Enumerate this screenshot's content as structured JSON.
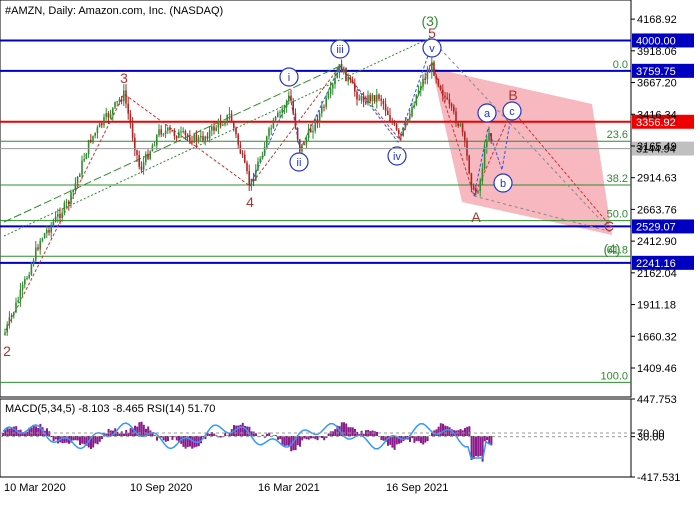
{
  "chart_data": {
    "type": "candlestick",
    "title": "#AMZN, Daily:  Amazon.com, Inc. (NASDAQ)",
    "x_ticks": [
      "10 Mar 2020",
      "10 Sep 2020",
      "16 Mar 2021",
      "16 Sep 2021"
    ],
    "price_axis": {
      "ylim": [
        1180,
        4320
      ],
      "ticks": [
        "4168.92",
        "3918.06",
        "3667.20",
        "3416.34",
        "3165.49",
        "2914.63",
        "2663.76",
        "2412.90",
        "2162.04",
        "1911.18",
        "1660.32",
        "1409.46"
      ]
    },
    "horizontal_levels": [
      {
        "label": "4000.00",
        "value": 4000.0,
        "color": "#0000c0"
      },
      {
        "label": "3759.75",
        "value": 3759.75,
        "color": "#0000c0"
      },
      {
        "label": "3356.92",
        "value": 3356.92,
        "color": "#ee0000"
      },
      {
        "label": "2529.07",
        "value": 2529.07,
        "color": "#0000c0"
      },
      {
        "label": "2241.16",
        "value": 2241.16,
        "color": "#0000c0"
      }
    ],
    "current_price": {
      "label": "3144.94",
      "value": 3144.94
    },
    "fibonacci_levels": [
      {
        "label": "0.0",
        "value": 3759.75
      },
      {
        "label": "23.6",
        "value": 3203
      },
      {
        "label": "38.2",
        "value": 2857
      },
      {
        "label": "50.0",
        "value": 2575
      },
      {
        "label": "61.8",
        "value": 2293
      },
      {
        "label": "100.0",
        "value": 1296
      }
    ],
    "wave_labels": [
      {
        "text": "(3)",
        "style": "green"
      },
      {
        "text": "5",
        "style": "red"
      },
      {
        "text": "3",
        "style": "red"
      },
      {
        "text": "4",
        "style": "red"
      },
      {
        "text": "2",
        "style": "red"
      },
      {
        "text": "A",
        "style": "red"
      },
      {
        "text": "B",
        "style": "red"
      },
      {
        "text": "C",
        "style": "red"
      },
      {
        "text": "(4)",
        "style": "green"
      },
      {
        "text": "i",
        "style": "circle"
      },
      {
        "text": "ii",
        "style": "circle"
      },
      {
        "text": "iii",
        "style": "circle"
      },
      {
        "text": "iv",
        "style": "circle"
      },
      {
        "text": "v",
        "style": "circle"
      },
      {
        "text": "a",
        "style": "circle"
      },
      {
        "text": "b",
        "style": "circle"
      },
      {
        "text": "c",
        "style": "circle"
      }
    ],
    "indicator": {
      "label": "MACD(5,34,5) -8.103 -8.465 RSI(14) 51.70",
      "ticks": [
        "447.753",
        "70.00",
        "30.00",
        "-417.531"
      ]
    },
    "colors": {
      "bull": "#2e8b2e",
      "bear": "#b22222",
      "level_blue": "#0000c0",
      "level_red": "#ee0000",
      "fib": "#2e8b2e",
      "channel": "#f4a0aa",
      "macd_hist": "#8b1a8b",
      "rsi": "#3399ff"
    }
  }
}
